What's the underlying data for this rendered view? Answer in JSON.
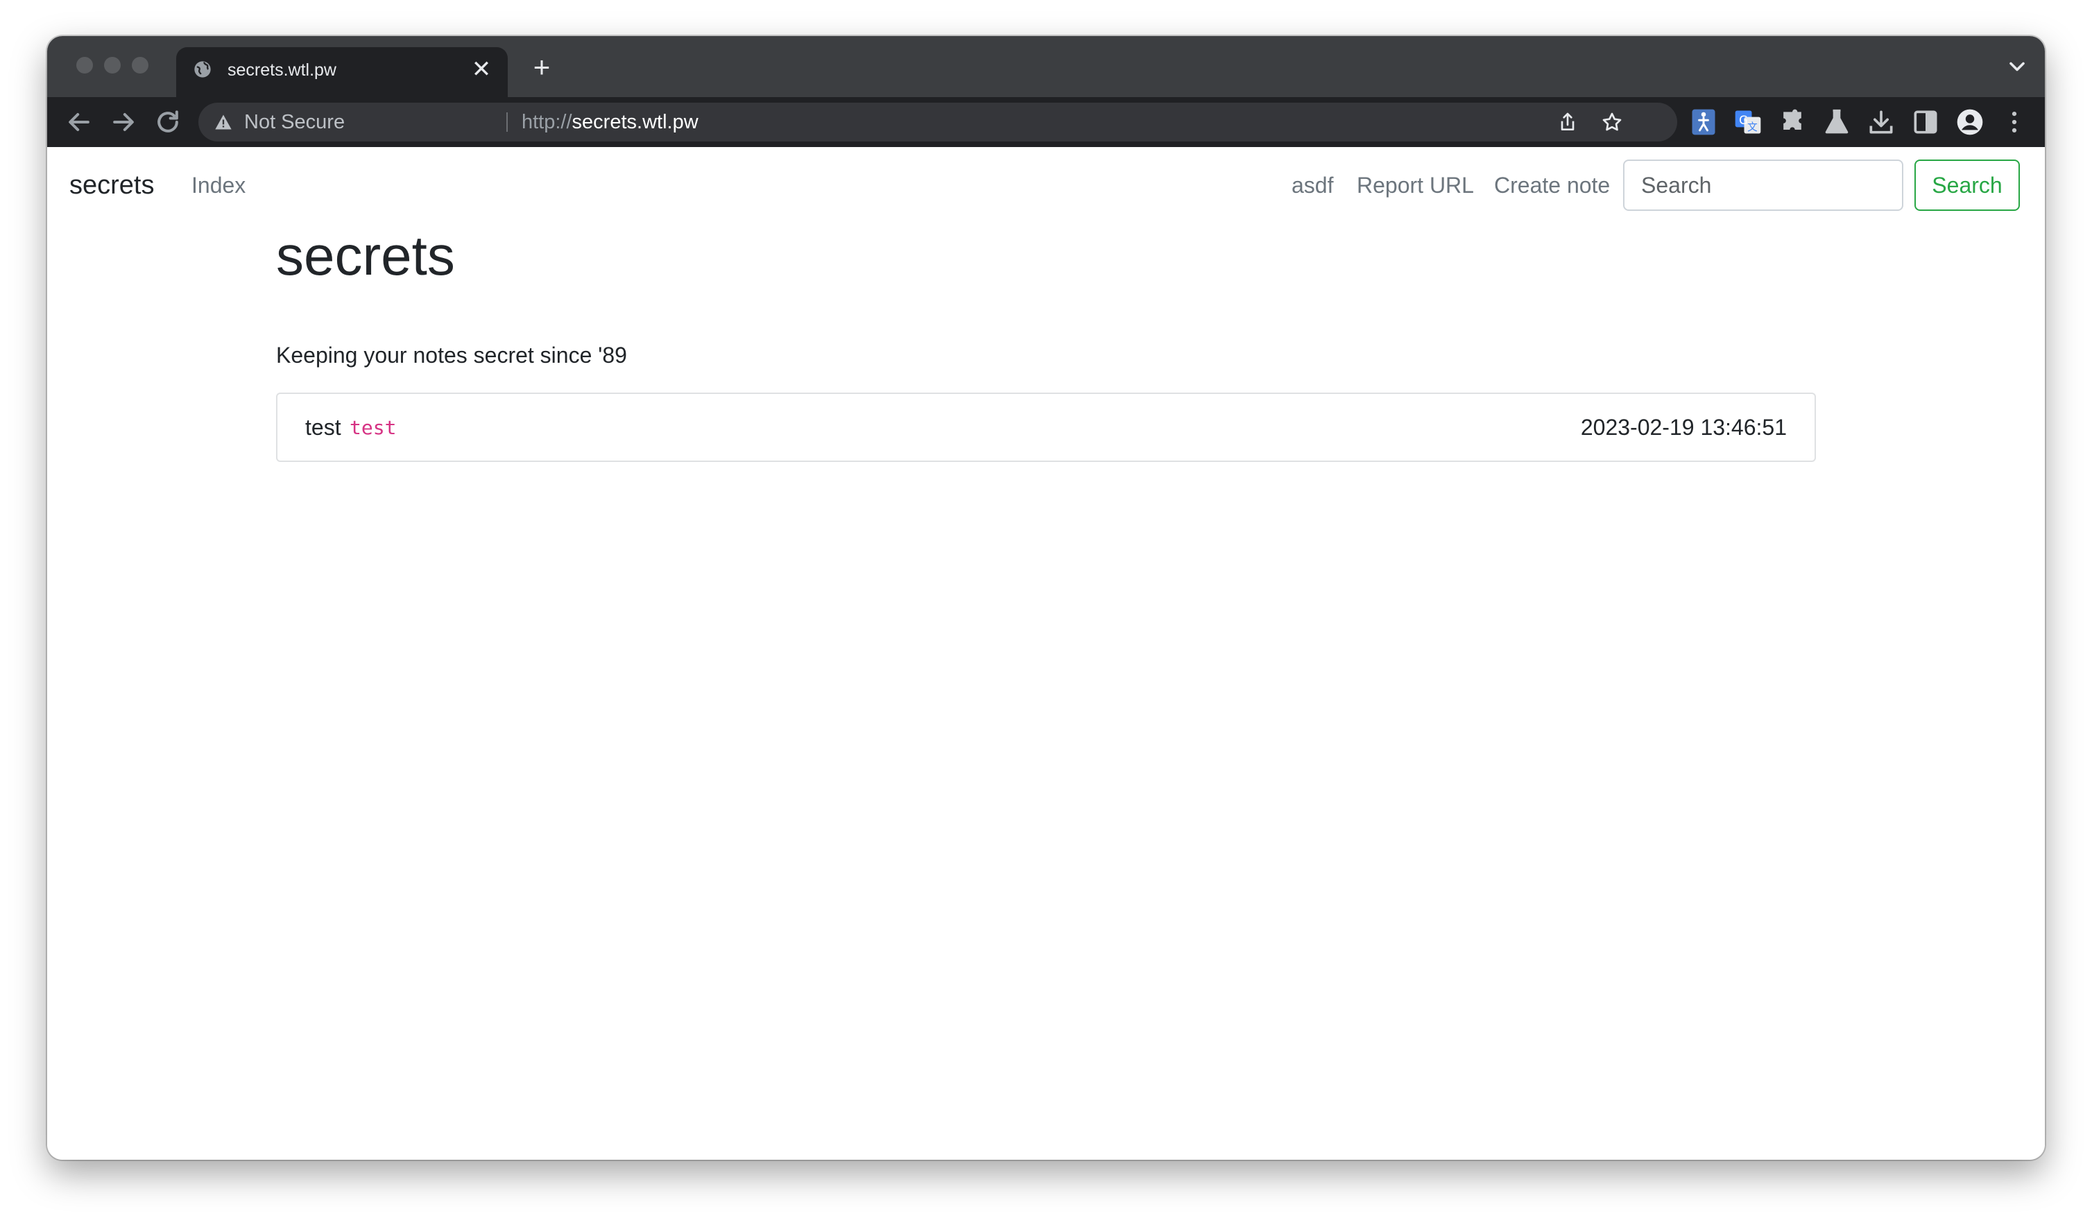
{
  "browser": {
    "tab_title": "secrets.wtl.pw",
    "close_glyph": "✕",
    "new_tab_glyph": "+",
    "security_label": "Not Secure",
    "url_scheme": "http://",
    "url_host": "secrets.wtl.pw",
    "icons": [
      "globe-icon",
      "close-icon",
      "plus-icon",
      "chevron-down-icon",
      "back-arrow-icon",
      "forward-arrow-icon",
      "reload-icon",
      "warning-icon",
      "share-icon",
      "star-icon",
      "accessibility-extension-icon",
      "translate-extension-icon",
      "puzzle-icon",
      "flask-icon",
      "download-icon",
      "side-panel-icon",
      "profile-icon",
      "more-vert-icon"
    ],
    "colors": {
      "tabstrip": "#3c3e41",
      "toolbar": "#202124",
      "omnibox": "#35363a"
    }
  },
  "navbar": {
    "brand": "secrets",
    "index_link": "Index",
    "user_link": "asdf",
    "report_link": "Report URL",
    "create_link": "Create note",
    "search_placeholder": "Search",
    "search_button": "Search"
  },
  "main": {
    "heading": "secrets",
    "lead": "Keeping your notes secret since '89",
    "notes": [
      {
        "title": "test",
        "code": "test",
        "timestamp": "2023-02-19 13:46:51"
      }
    ]
  },
  "colors": {
    "accent_success": "#28a745",
    "code_pink": "#d63384",
    "muted_text": "#6c757d"
  }
}
